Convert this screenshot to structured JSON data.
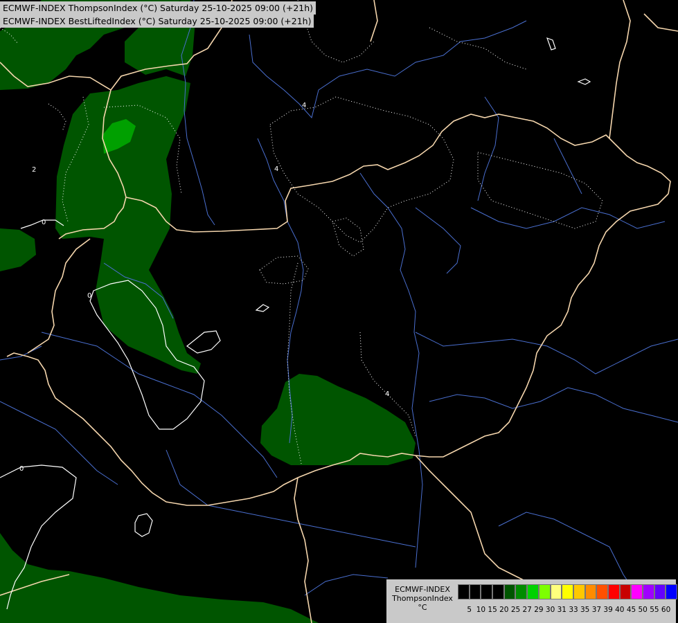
{
  "header": {
    "title_line1": "ECMWF-INDEX ThompsonIndex (°C) Saturday 25-10-2025 09:00 (+21h)",
    "title_line2": "ECMWF-INDEX BestLiftedIndex (°C) Saturday 25-10-2025 09:00 (+21h)"
  },
  "legend": {
    "label_line1": "ECMWF-INDEX",
    "label_line2": "ThompsonIndex",
    "label_line3": "°C",
    "ticks": [
      "5",
      "10",
      "15",
      "20",
      "25",
      "27",
      "29",
      "30",
      "31",
      "33",
      "35",
      "37",
      "39",
      "40",
      "45",
      "50",
      "55",
      "60"
    ],
    "colors": [
      "#000000",
      "#000000",
      "#000000",
      "#000000",
      "#005500",
      "#008c00",
      "#00d200",
      "#7dff00",
      "#ffff7d",
      "#ffff00",
      "#ffc800",
      "#ff8c00",
      "#ff5000",
      "#ff0000",
      "#c80000",
      "#ff00ff",
      "#a000ff",
      "#6400ff",
      "#0000ff"
    ]
  },
  "contour_labels": {
    "c1": "4",
    "c2": "4",
    "c3": "2",
    "c4": "0",
    "c5": "0",
    "c6": "0",
    "c7": "4"
  },
  "colors": {
    "thompson_25": "#005500",
    "thompson_27": "#008c00",
    "borders": "#f5d6ad",
    "rivers": "#4a6fd0",
    "lifted_contours": "#ffffff"
  }
}
